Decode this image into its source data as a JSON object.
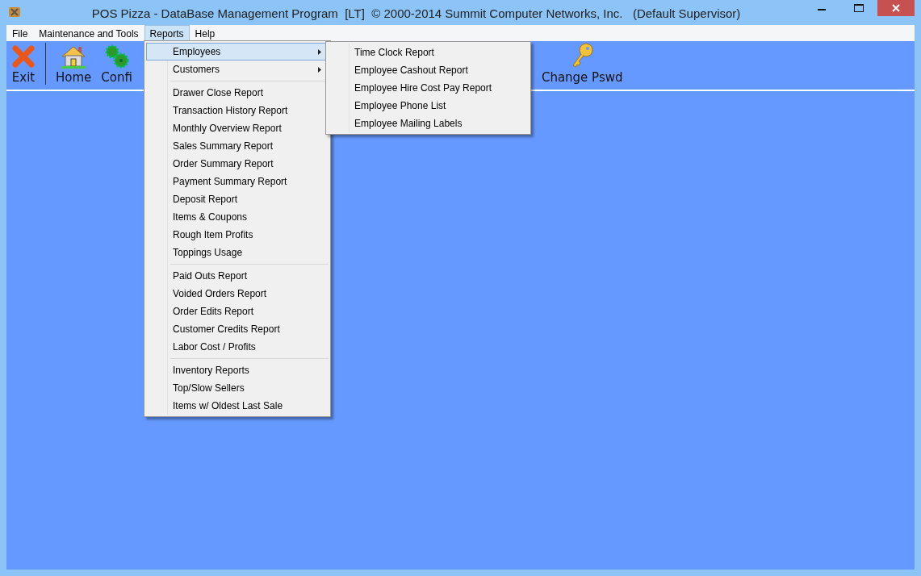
{
  "window": {
    "title": "POS Pizza - DataBase Management Program  [LT]  © 2000-2014 Summit Computer Networks, Inc.   (Default Supervisor)"
  },
  "menu_bar": [
    {
      "label": "File",
      "selected": false
    },
    {
      "label": "Maintenance and Tools",
      "selected": false
    },
    {
      "label": "Reports",
      "selected": true
    },
    {
      "label": "Help",
      "selected": false
    }
  ],
  "toolbar": [
    {
      "kind": "exit",
      "label": "Exit"
    },
    {
      "kind": "home",
      "label": "Home"
    },
    {
      "kind": "config",
      "label": "Confi"
    },
    {
      "kind": "key",
      "label": "Change Pswd"
    }
  ],
  "reports_menu": {
    "groups": [
      [
        {
          "label": "Employees",
          "submenu": true,
          "selected": true
        },
        {
          "label": "Customers",
          "submenu": true,
          "selected": false
        }
      ],
      [
        {
          "label": "Drawer Close Report",
          "submenu": false,
          "selected": false
        },
        {
          "label": "Transaction History Report",
          "submenu": false,
          "selected": false
        },
        {
          "label": "Monthly Overview Report",
          "submenu": false,
          "selected": false
        },
        {
          "label": "Sales Summary Report",
          "submenu": false,
          "selected": false
        },
        {
          "label": "Order Summary Report",
          "submenu": false,
          "selected": false
        },
        {
          "label": "Payment Summary Report",
          "submenu": false,
          "selected": false
        },
        {
          "label": "Deposit Report",
          "submenu": false,
          "selected": false
        },
        {
          "label": "Items & Coupons",
          "submenu": false,
          "selected": false
        },
        {
          "label": "Rough Item Profits",
          "submenu": false,
          "selected": false
        },
        {
          "label": "Toppings Usage",
          "submenu": false,
          "selected": false
        }
      ],
      [
        {
          "label": "Paid Outs Report",
          "submenu": false,
          "selected": false
        },
        {
          "label": "Voided Orders Report",
          "submenu": false,
          "selected": false
        },
        {
          "label": "Order Edits Report",
          "submenu": false,
          "selected": false
        },
        {
          "label": "Customer Credits Report",
          "submenu": false,
          "selected": false
        },
        {
          "label": "Labor Cost / Profits",
          "submenu": false,
          "selected": false
        }
      ],
      [
        {
          "label": "Inventory Reports",
          "submenu": false,
          "selected": false
        },
        {
          "label": "Top/Slow Sellers",
          "submenu": false,
          "selected": false
        },
        {
          "label": "Items w/ Oldest Last Sale",
          "submenu": false,
          "selected": false
        }
      ]
    ]
  },
  "employees_submenu": {
    "items": [
      "Time Clock Report",
      "Employee Cashout Report",
      "Employee Hire Cost Pay Report",
      "Employee Phone List",
      "Employee Mailing Labels"
    ]
  }
}
